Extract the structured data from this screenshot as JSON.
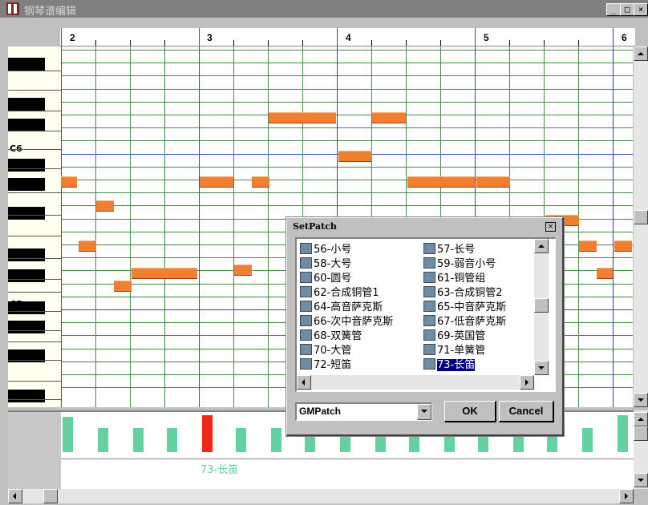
{
  "window": {
    "title": "钢琴谱编辑",
    "min_label": "_",
    "max_label": "□",
    "close_label": "×"
  },
  "ruler": {
    "measures": [
      "2",
      "3",
      "4",
      "5",
      "6"
    ]
  },
  "keyboard": {
    "c6_label": "C6",
    "c5_label": "C5"
  },
  "velocity": {
    "selected_label": "73-长笛"
  },
  "dialog": {
    "title": "SetPatch",
    "close_label": "×",
    "left_items": [
      "56-小号",
      "58-大号",
      "60-圆号",
      "62-合成铜管1",
      "64-高音萨克斯",
      "66-次中音萨克斯",
      "68-双簧管",
      "70-大管",
      "72-短笛"
    ],
    "right_items": [
      "57-长号",
      "59-弱音小号",
      "61-铜管组",
      "63-合成铜管2",
      "65-中音萨克斯",
      "67-低音萨克斯",
      "69-英国管",
      "71-单簧管",
      "73-长笛"
    ],
    "selected_item": "73-长笛",
    "bank_select": "GMPatch",
    "ok_label": "OK",
    "cancel_label": "Cancel"
  },
  "colors": {
    "note": "#f08030",
    "velocity_bar": "#64d2a0",
    "velocity_selected": "#f02818",
    "grid": "#4a8a4a",
    "bar_line": "#2a4ab8"
  }
}
